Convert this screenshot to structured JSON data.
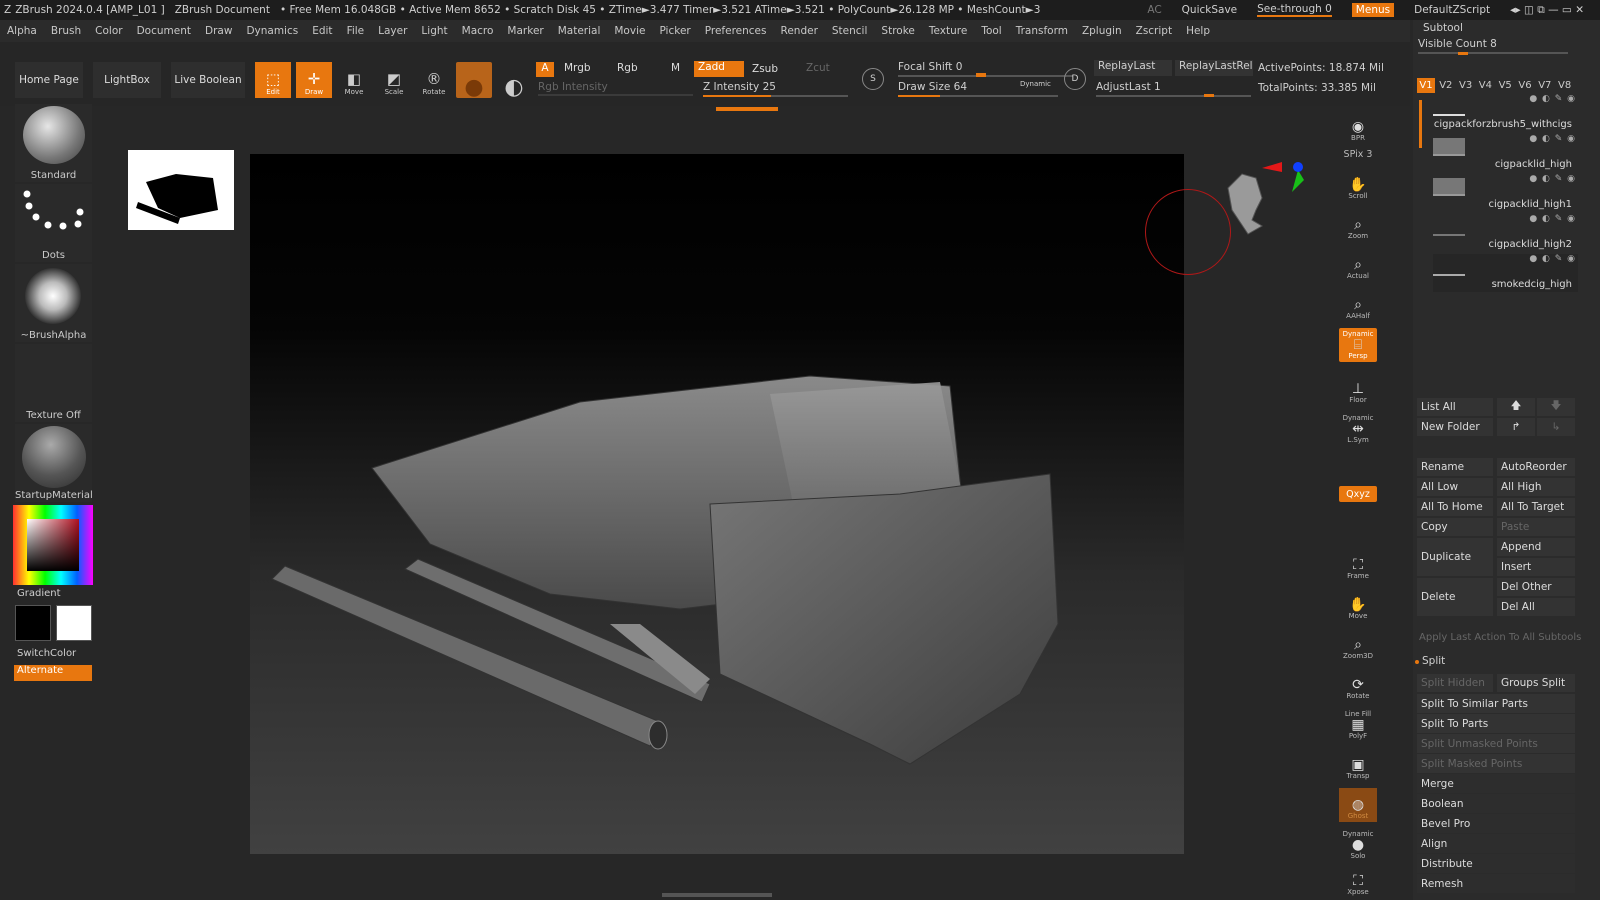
{
  "titlebar": {
    "app": "ZBrush 2024.0.4 [AMP_L01 ]",
    "doc": "ZBrush Document",
    "stats": "• Free Mem 16.048GB • Active Mem 8652 • Scratch Disk 45 • ZTime►3.477 Timer►3.521 ATime►3.521 • PolyCount►26.128 MP • MeshCount►3",
    "ac": "AC",
    "quicksave": "QuickSave",
    "seethrough": "See-through  0",
    "menus": "Menus",
    "zscript": "DefaultZScript"
  },
  "menubar": [
    "Alpha",
    "Brush",
    "Color",
    "Document",
    "Draw",
    "Dynamics",
    "Edit",
    "File",
    "Layer",
    "Light",
    "Macro",
    "Marker",
    "Material",
    "Movie",
    "Picker",
    "Preferences",
    "Render",
    "Stencil",
    "Stroke",
    "Texture",
    "Tool",
    "Transform",
    "Zplugin",
    "Zscript",
    "Help"
  ],
  "shelf": {
    "home": "Home Page",
    "lightbox": "LightBox",
    "liveboolean": "Live Boolean",
    "edit": "Edit",
    "draw": "Draw",
    "move": "Move",
    "scale": "Scale",
    "rotate": "Rotate",
    "a": "A",
    "mrgb": "Mrgb",
    "rgb": "Rgb",
    "m": "M",
    "zadd": "Zadd",
    "zsub": "Zsub",
    "zcut": "Zcut",
    "rgb_intensity": "Rgb Intensity",
    "z_intensity": "Z Intensity 25",
    "z_intensity_value": 25,
    "focal_shift": "Focal Shift 0",
    "draw_size": "Draw Size 64",
    "dynamic": "Dynamic",
    "replaylast": "ReplayLast",
    "replaylastrel": "ReplayLastRel",
    "adjustlast": "AdjustLast 1",
    "activepoints": "ActivePoints: 18.874 Mil",
    "totalpoints": "TotalPoints: 33.385 Mil"
  },
  "lefttray": {
    "standard": "Standard",
    "dots": "Dots",
    "brushalpha": "~BrushAlpha",
    "textureoff": "Texture Off",
    "material": "StartupMaterial",
    "gradient": "Gradient",
    "switchcolor": "SwitchColor",
    "alternate": "Alternate"
  },
  "rightbar": {
    "bpr": "BPR",
    "spix": "SPix 3",
    "scroll": "Scroll",
    "zoom": "Zoom",
    "actual": "Actual",
    "aahalf": "AAHalf",
    "persp_top": "Dynamic",
    "persp": "Persp",
    "floor": "Floor",
    "lsym_top": "Dynamic",
    "lsym": "L.Sym",
    "xyz": "Qxyz",
    "frame": "Frame",
    "move": "Move",
    "zoom3d": "Zoom3D",
    "rotate": "Rotate",
    "linefill_top": "Line Fill",
    "polyf": "PolyF",
    "transp": "Transp",
    "ghost": "Ghost",
    "solo_top": "Dynamic",
    "solo": "Solo",
    "xpose": "Xpose"
  },
  "subtool": {
    "title": "Subtool",
    "visible_count": "Visible Count 8",
    "tabs": [
      "V1",
      "V2",
      "V3",
      "V4",
      "V5",
      "V6",
      "V7",
      "V8"
    ],
    "items": [
      "cigpackforzbrush5_withcigs",
      "cigpacklid_high",
      "cigpacklid_high1",
      "cigpacklid_high2",
      "smokedcig_high"
    ],
    "buttons": {
      "listall": "List All",
      "newfolder": "New Folder",
      "rename": "Rename",
      "autoreorder": "AutoReorder",
      "alllow": "All Low",
      "allhigh": "All High",
      "allhome": "All To Home",
      "alltarget": "All To Target",
      "copy": "Copy",
      "paste": "Paste",
      "duplicate": "Duplicate",
      "append": "Append",
      "insert": "Insert",
      "delete": "Delete",
      "delother": "Del Other",
      "delall": "Del All",
      "applylast": "Apply Last Action To All Subtools",
      "split": "Split",
      "splithidden": "Split Hidden",
      "groupssplit": "Groups Split",
      "splitsimilar": "Split To Similar Parts",
      "splitparts": "Split To Parts",
      "splitunmasked": "Split Unmasked Points",
      "splitmasked": "Split Masked Points",
      "merge": "Merge",
      "boolean": "Boolean",
      "bevelpro": "Bevel Pro",
      "align": "Align",
      "distribute": "Distribute",
      "remesh": "Remesh"
    }
  },
  "colors": {
    "accent": "#e8770f",
    "bg": "#272727"
  }
}
